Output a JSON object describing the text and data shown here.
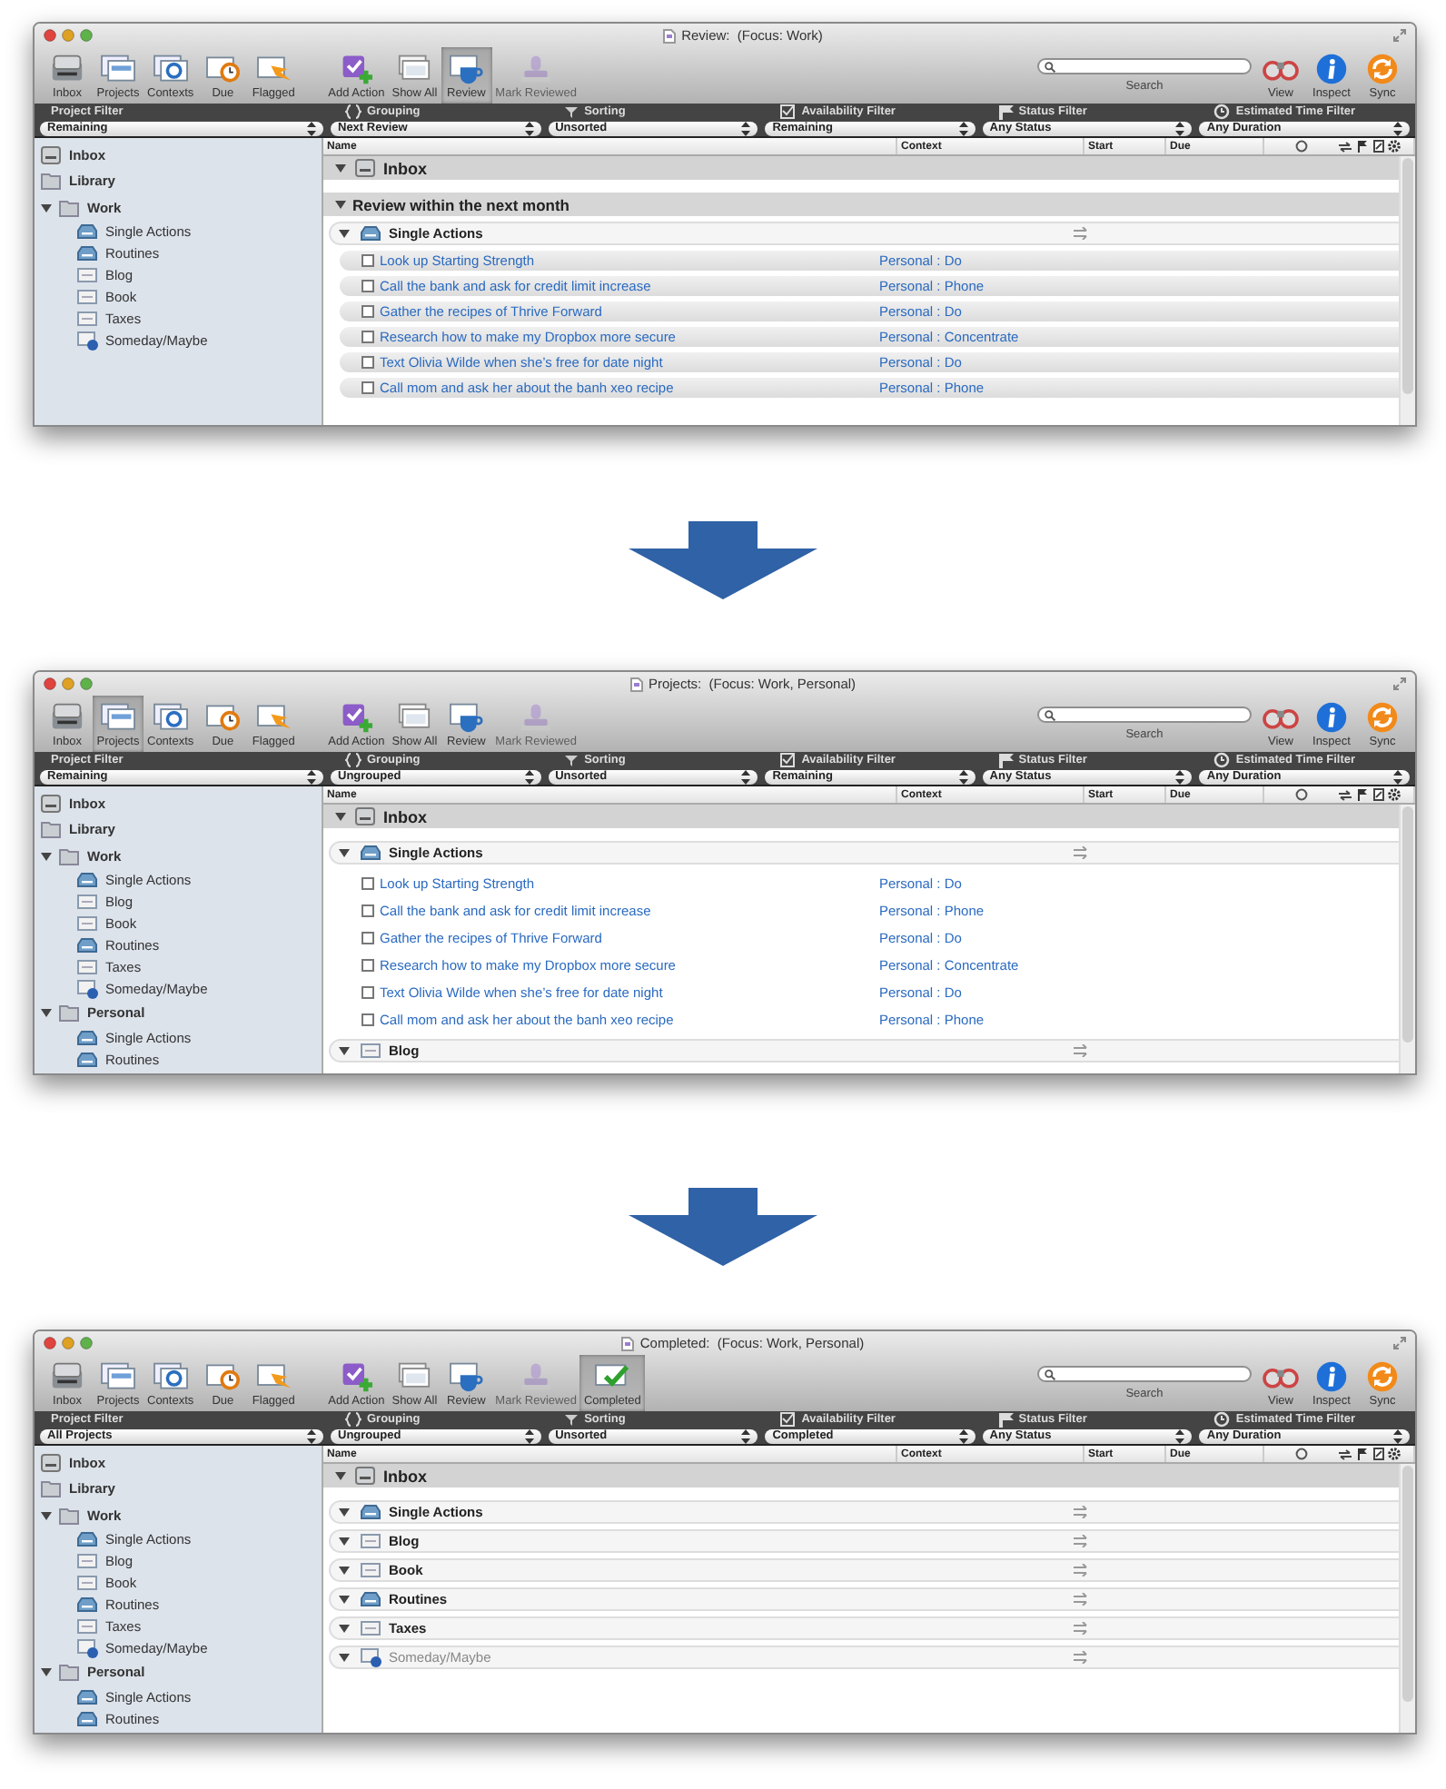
{
  "windows": [
    {
      "title": "Review:  (Focus: Work)",
      "views": [
        {
          "label": "Inbox",
          "kind": "inbox",
          "selected": false
        },
        {
          "label": "Projects",
          "kind": "projects",
          "selected": false
        },
        {
          "label": "Contexts",
          "kind": "contexts",
          "selected": false
        },
        {
          "label": "Due",
          "kind": "due",
          "selected": false
        },
        {
          "label": "Flagged",
          "kind": "flagged",
          "selected": false
        }
      ],
      "actions": [
        {
          "label": "Add Action",
          "kind": "add",
          "selected": false,
          "disabled": false
        },
        {
          "label": "Show All",
          "kind": "showall",
          "selected": false,
          "disabled": false
        },
        {
          "label": "Review",
          "kind": "review",
          "selected": true,
          "disabled": false
        },
        {
          "label": "Mark Reviewed",
          "kind": "mark",
          "selected": false,
          "disabled": true
        }
      ],
      "search_label": "Search",
      "right_tools": [
        {
          "label": "View",
          "kind": "view"
        },
        {
          "label": "Inspect",
          "kind": "inspect"
        },
        {
          "label": "Sync",
          "kind": "sync"
        }
      ],
      "filters": [
        {
          "label": "Project Filter",
          "kind": "plain",
          "value": "Remaining"
        },
        {
          "label": "Grouping",
          "kind": "grouping",
          "value": "Next Review"
        },
        {
          "label": "Sorting",
          "kind": "sorting",
          "value": "Unsorted"
        },
        {
          "label": "Availability Filter",
          "kind": "availability",
          "value": "Remaining"
        },
        {
          "label": "Status Filter",
          "kind": "status",
          "value": "Any Status"
        },
        {
          "label": "Estimated Time Filter",
          "kind": "time",
          "value": "Any Duration"
        }
      ],
      "sidebar": [
        {
          "label": "Inbox",
          "kind": "inbox"
        },
        {
          "label": "Library",
          "kind": "library"
        },
        {
          "label": "Work",
          "kind": "folder",
          "expanded": true,
          "children": [
            {
              "label": "Single Actions",
              "kind": "single"
            },
            {
              "label": "Routines",
              "kind": "single"
            },
            {
              "label": "Blog",
              "kind": "project"
            },
            {
              "label": "Book",
              "kind": "project"
            },
            {
              "label": "Taxes",
              "kind": "project"
            },
            {
              "label": "Someday/Maybe",
              "kind": "someday"
            }
          ]
        }
      ],
      "columns": [
        "Name",
        "Context",
        "Start",
        "Due"
      ],
      "rows": [
        {
          "kind": "inbox",
          "label": "Inbox",
          "expanded": true
        },
        {
          "kind": "section",
          "label": "Review within the next month",
          "expanded": true
        },
        {
          "kind": "single",
          "label": "Single Actions",
          "expanded": true,
          "dimmed": false
        },
        {
          "kind": "action",
          "label": "Look up Starting Strength",
          "context": "Personal : Do",
          "checked": false,
          "shaded": true
        },
        {
          "kind": "action",
          "label": "Call the bank and ask for credit limit increase",
          "context": "Personal : Phone",
          "checked": false,
          "shaded": true
        },
        {
          "kind": "action",
          "label": "Gather the recipes of Thrive Forward",
          "context": "Personal : Do",
          "checked": false,
          "shaded": true
        },
        {
          "kind": "action",
          "label": "Research how to make my Dropbox more secure",
          "context": "Personal : Concentrate",
          "checked": false,
          "shaded": true
        },
        {
          "kind": "action",
          "label": "Text Olivia Wilde when she’s free for date night",
          "context": "Personal : Do",
          "checked": false,
          "shaded": true
        },
        {
          "kind": "action",
          "label": "Call mom and ask her about the banh xeo recipe",
          "context": "Personal : Phone",
          "checked": false,
          "shaded": true
        }
      ]
    },
    {
      "title": "Projects:  (Focus: Work, Personal)",
      "views": [
        {
          "label": "Inbox",
          "kind": "inbox",
          "selected": false
        },
        {
          "label": "Projects",
          "kind": "projects",
          "selected": true
        },
        {
          "label": "Contexts",
          "kind": "contexts",
          "selected": false
        },
        {
          "label": "Due",
          "kind": "due",
          "selected": false
        },
        {
          "label": "Flagged",
          "kind": "flagged",
          "selected": false
        }
      ],
      "actions": [
        {
          "label": "Add Action",
          "kind": "add",
          "selected": false,
          "disabled": false
        },
        {
          "label": "Show All",
          "kind": "showall",
          "selected": false,
          "disabled": false
        },
        {
          "label": "Review",
          "kind": "review",
          "selected": false,
          "disabled": false
        },
        {
          "label": "Mark Reviewed",
          "kind": "mark",
          "selected": false,
          "disabled": true
        }
      ],
      "search_label": "Search",
      "right_tools": [
        {
          "label": "View",
          "kind": "view"
        },
        {
          "label": "Inspect",
          "kind": "inspect"
        },
        {
          "label": "Sync",
          "kind": "sync"
        }
      ],
      "filters": [
        {
          "label": "Project Filter",
          "kind": "plain",
          "value": "Remaining"
        },
        {
          "label": "Grouping",
          "kind": "grouping",
          "value": "Ungrouped"
        },
        {
          "label": "Sorting",
          "kind": "sorting",
          "value": "Unsorted"
        },
        {
          "label": "Availability Filter",
          "kind": "availability",
          "value": "Remaining"
        },
        {
          "label": "Status Filter",
          "kind": "status",
          "value": "Any Status"
        },
        {
          "label": "Estimated Time Filter",
          "kind": "time",
          "value": "Any Duration"
        }
      ],
      "sidebar": [
        {
          "label": "Inbox",
          "kind": "inbox"
        },
        {
          "label": "Library",
          "kind": "library"
        },
        {
          "label": "Work",
          "kind": "folder",
          "expanded": true,
          "children": [
            {
              "label": "Single Actions",
              "kind": "single"
            },
            {
              "label": "Blog",
              "kind": "project"
            },
            {
              "label": "Book",
              "kind": "project"
            },
            {
              "label": "Routines",
              "kind": "single"
            },
            {
              "label": "Taxes",
              "kind": "project"
            },
            {
              "label": "Someday/Maybe",
              "kind": "someday"
            }
          ]
        },
        {
          "label": "Personal",
          "kind": "folder",
          "expanded": true,
          "children": [
            {
              "label": "Single Actions",
              "kind": "single"
            },
            {
              "label": "Routines",
              "kind": "single"
            }
          ]
        }
      ],
      "columns": [
        "Name",
        "Context",
        "Start",
        "Due"
      ],
      "rows": [
        {
          "kind": "inbox",
          "label": "Inbox",
          "expanded": true
        },
        {
          "kind": "single",
          "label": "Single Actions",
          "expanded": true,
          "dimmed": false
        },
        {
          "kind": "action",
          "label": "Look up Starting Strength",
          "context": "Personal : Do",
          "checked": false,
          "shaded": false
        },
        {
          "kind": "action",
          "label": "Call the bank and ask for credit limit increase",
          "context": "Personal : Phone",
          "checked": false,
          "shaded": false
        },
        {
          "kind": "action",
          "label": "Gather the recipes of Thrive Forward",
          "context": "Personal : Do",
          "checked": false,
          "shaded": false
        },
        {
          "kind": "action",
          "label": "Research how to make my Dropbox more secure",
          "context": "Personal : Concentrate",
          "checked": false,
          "shaded": false
        },
        {
          "kind": "action",
          "label": "Text Olivia Wilde when she’s free for date night",
          "context": "Personal : Do",
          "checked": false,
          "shaded": false
        },
        {
          "kind": "action",
          "label": "Call mom and ask her about the banh xeo recipe",
          "context": "Personal : Phone",
          "checked": false,
          "shaded": false
        },
        {
          "kind": "list",
          "label": "Blog",
          "expanded": true,
          "dimmed": false
        }
      ]
    },
    {
      "title": "Completed:  (Focus: Work, Personal)",
      "views": [
        {
          "label": "Inbox",
          "kind": "inbox",
          "selected": false
        },
        {
          "label": "Projects",
          "kind": "projects",
          "selected": false
        },
        {
          "label": "Contexts",
          "kind": "contexts",
          "selected": false
        },
        {
          "label": "Due",
          "kind": "due",
          "selected": false
        },
        {
          "label": "Flagged",
          "kind": "flagged",
          "selected": false
        }
      ],
      "actions": [
        {
          "label": "Add Action",
          "kind": "add",
          "selected": false,
          "disabled": false
        },
        {
          "label": "Show All",
          "kind": "showall",
          "selected": false,
          "disabled": false
        },
        {
          "label": "Review",
          "kind": "review",
          "selected": false,
          "disabled": false
        },
        {
          "label": "Mark Reviewed",
          "kind": "mark",
          "selected": false,
          "disabled": true
        },
        {
          "label": "Completed",
          "kind": "completed",
          "selected": true,
          "disabled": false
        }
      ],
      "search_label": "Search",
      "right_tools": [
        {
          "label": "View",
          "kind": "view"
        },
        {
          "label": "Inspect",
          "kind": "inspect"
        },
        {
          "label": "Sync",
          "kind": "sync"
        }
      ],
      "filters": [
        {
          "label": "Project Filter",
          "kind": "plain",
          "value": "All Projects"
        },
        {
          "label": "Grouping",
          "kind": "grouping",
          "value": "Ungrouped"
        },
        {
          "label": "Sorting",
          "kind": "sorting",
          "value": "Unsorted"
        },
        {
          "label": "Availability Filter",
          "kind": "availability",
          "value": "Completed"
        },
        {
          "label": "Status Filter",
          "kind": "status",
          "value": "Any Status"
        },
        {
          "label": "Estimated Time Filter",
          "kind": "time",
          "value": "Any Duration"
        }
      ],
      "sidebar": [
        {
          "label": "Inbox",
          "kind": "inbox"
        },
        {
          "label": "Library",
          "kind": "library"
        },
        {
          "label": "Work",
          "kind": "folder",
          "expanded": true,
          "children": [
            {
              "label": "Single Actions",
              "kind": "single"
            },
            {
              "label": "Blog",
              "kind": "project"
            },
            {
              "label": "Book",
              "kind": "project"
            },
            {
              "label": "Routines",
              "kind": "single"
            },
            {
              "label": "Taxes",
              "kind": "project"
            },
            {
              "label": "Someday/Maybe",
              "kind": "someday"
            }
          ]
        },
        {
          "label": "Personal",
          "kind": "folder",
          "expanded": true,
          "children": [
            {
              "label": "Single Actions",
              "kind": "single"
            },
            {
              "label": "Routines",
              "kind": "single"
            }
          ]
        }
      ],
      "columns": [
        "Name",
        "Context",
        "Start",
        "Due"
      ],
      "rows": [
        {
          "kind": "inbox",
          "label": "Inbox",
          "expanded": true
        },
        {
          "kind": "single",
          "label": "Single Actions",
          "expanded": true,
          "dimmed": false
        },
        {
          "kind": "list",
          "label": "Blog",
          "expanded": true,
          "dimmed": false
        },
        {
          "kind": "list",
          "label": "Book",
          "expanded": true,
          "dimmed": false
        },
        {
          "kind": "single",
          "label": "Routines",
          "expanded": true,
          "dimmed": false
        },
        {
          "kind": "list",
          "label": "Taxes",
          "expanded": true,
          "dimmed": false
        },
        {
          "kind": "someday",
          "label": "Someday/Maybe",
          "expanded": true,
          "dimmed": true
        }
      ]
    }
  ]
}
